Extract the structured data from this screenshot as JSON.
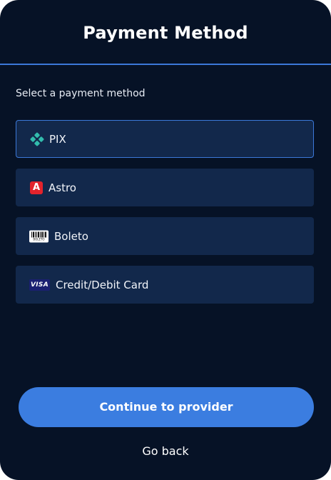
{
  "header": {
    "title": "Payment Method"
  },
  "main": {
    "prompt": "Select a payment method",
    "options": [
      {
        "label": "PIX",
        "icon": "pix-icon",
        "selected": true
      },
      {
        "label": "Astro",
        "icon": "astro-icon",
        "selected": false,
        "icon_letter": "A"
      },
      {
        "label": "Boleto",
        "icon": "barcode-icon",
        "selected": false,
        "icon_text": "BOLETO"
      },
      {
        "label": "Credit/Debit Card",
        "icon": "visa-icon",
        "selected": false,
        "icon_text": "VISA"
      }
    ]
  },
  "footer": {
    "continue_label": "Continue to provider",
    "back_label": "Go back"
  },
  "colors": {
    "background": "#061226",
    "option_background": "#12284b",
    "accent": "#3b7de0",
    "pix": "#32bcad",
    "astro": "#e3232c",
    "visa": "#1a1f71"
  }
}
